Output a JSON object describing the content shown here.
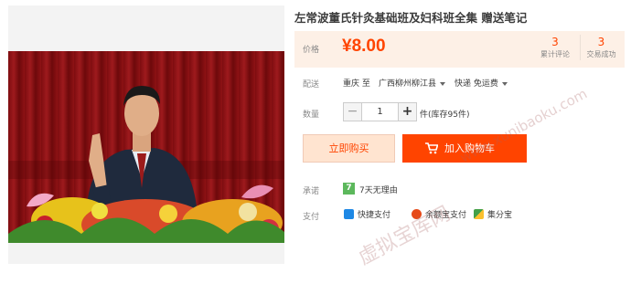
{
  "product": {
    "title": "左常波董氏针灸基础班及妇科班全集 赠送笔记"
  },
  "price": {
    "label": "价格",
    "value": "¥8.00"
  },
  "stats": [
    {
      "count": "3",
      "label": "累计评论"
    },
    {
      "count": "3",
      "label": "交易成功"
    }
  ],
  "shipping": {
    "label": "配送",
    "from": "重庆 至",
    "to": "广西柳州柳江县",
    "method": "快递 免运费"
  },
  "quantity": {
    "label": "数量",
    "minus": "−",
    "value": "1",
    "plus": "+",
    "stock": "件(库存95件)"
  },
  "actions": {
    "buy_now": "立即购买",
    "add_to_cart": "加入购物车"
  },
  "promise": {
    "label": "承诺",
    "icon_text": "7",
    "text": "7天无理由"
  },
  "payment": {
    "label": "支付",
    "methods": [
      "快捷支付",
      "余额宝支付",
      "集分宝"
    ]
  },
  "watermark": {
    "site": "www.xunibaoku.com",
    "name": "虚拟宝库网"
  },
  "colors": {
    "accent": "#ff4400",
    "price_bg": "#fdf0e6",
    "buy_now_bg": "#ffe4d0"
  }
}
